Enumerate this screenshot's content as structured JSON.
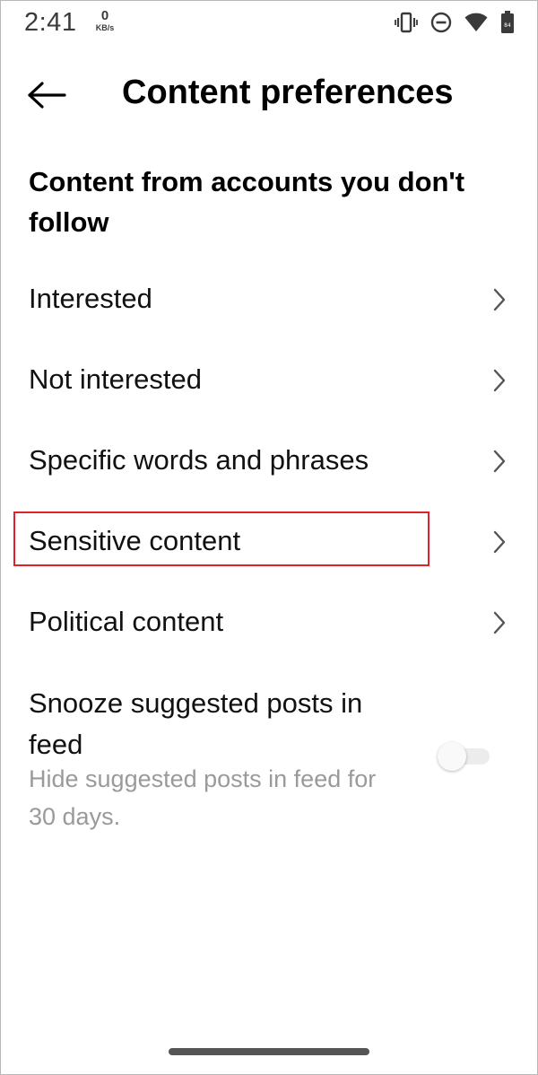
{
  "status_bar": {
    "time": "2:41",
    "net_speed_value": "0",
    "net_speed_unit": "KB/s",
    "battery_level": "84"
  },
  "header": {
    "title": "Content preferences"
  },
  "section": {
    "heading": "Content from accounts you don't follow"
  },
  "menu": {
    "items": [
      {
        "label": "Interested"
      },
      {
        "label": "Not interested"
      },
      {
        "label": "Specific words and phrases"
      },
      {
        "label": "Sensitive content"
      },
      {
        "label": "Political content"
      }
    ]
  },
  "snooze": {
    "title": "Snooze suggested posts in feed",
    "subtitle": "Hide suggested posts in feed for 30 days.",
    "enabled": false
  },
  "colors": {
    "highlight": "#e0202a",
    "secondary_text": "#9a9a9a"
  }
}
